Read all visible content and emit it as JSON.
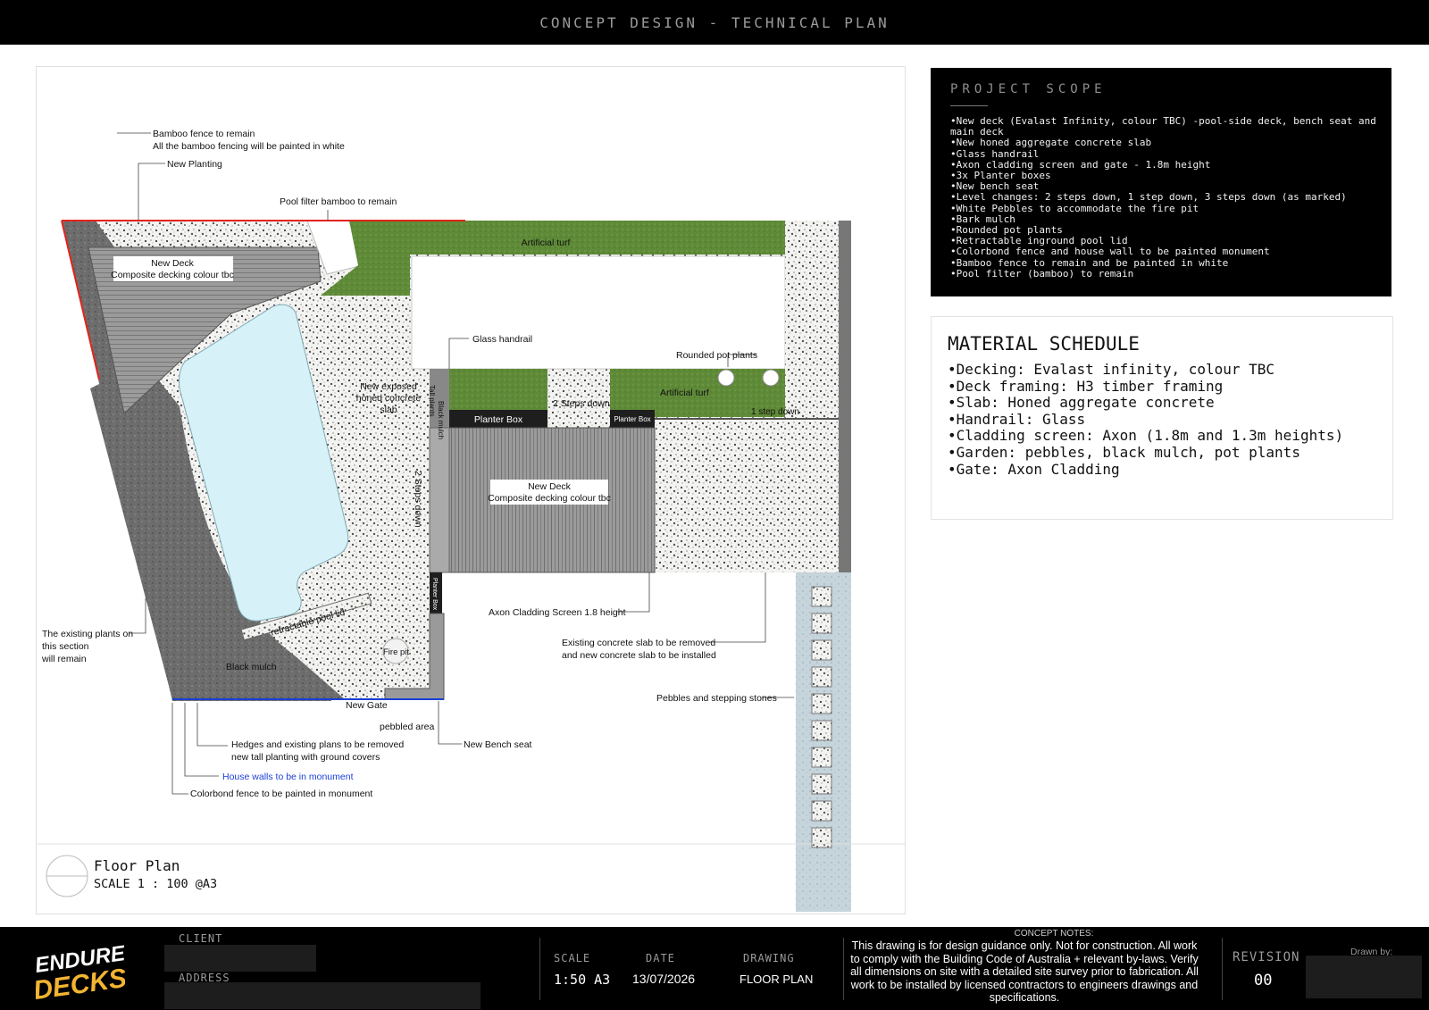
{
  "header": {
    "title": "CONCEPT DESIGN - TECHNICAL PLAN"
  },
  "plan": {
    "labels": {
      "bamboo_remain": "Bamboo fence to remain",
      "bamboo_paint": "All the bamboo fencing will be painted in white",
      "new_planting": "New Planting",
      "pool_filter": "Pool filter bamboo to remain",
      "deck1_title": "New Deck",
      "deck1_sub": "Composite decking colour tbc",
      "artificial_turf_top": "Artificial turf",
      "glass_handrail": "Glass handrail",
      "rounded_pot": "Rounded pot plants",
      "new_exposed": "New exposed honed concrete slab",
      "black_mulch_small": "Black mulch",
      "tall_plants": "Tall plants",
      "two_steps_top": "2 Steps down",
      "artificial_turf_mid": "Artificial turf",
      "planter_box_1": "Planter Box",
      "planter_box_2": "Planter Box",
      "one_step": "1 step down",
      "two_steps_side": "2 Steps down",
      "deck2_title": "New Deck",
      "deck2_sub": "Composite decking colour tbc",
      "planter_box_3": "Planter Box",
      "axon_screen": "Axon Cladding Screen 1.8 height",
      "existing_slab_1": "Existing concrete slab to be removed",
      "existing_slab_2": "and new concrete slab to be installed",
      "pebbles_stones": "Pebbles and stepping stones",
      "retractable": "retractable pool lid",
      "fire_pit": "Fire pit",
      "black_mulch": "Black mulch",
      "existing_plants_1": "The existing plants on",
      "existing_plants_2": "this section",
      "existing_plants_3": "will remain",
      "new_gate": "New Gate",
      "pebbled_area": "pebbled area",
      "new_bench": "New Bench seat",
      "hedges_1": "Hedges and existing plans to be removed",
      "hedges_2": "new tall planting with ground covers",
      "house_walls": "House walls to be in monument",
      "colorbond": "Colorbond fence to be painted in monument"
    },
    "caption": {
      "title": "Floor Plan",
      "scale": "SCALE 1 : 100 @A3"
    },
    "colors": {
      "grass": "#5f8a38",
      "pool": "#d6f2f8",
      "fence_red": "#e2231a",
      "wall_blue": "#1a3fd6",
      "mulch": "#6b6b6b",
      "deck": "#9a9a9a"
    }
  },
  "scope": {
    "title": "PROJECT SCOPE",
    "items": [
      "•New deck (Evalast Infinity, colour TBC) -pool-side deck, bench seat and main deck",
      "•New honed aggregate concrete slab",
      "•Glass handrail",
      "•Axon cladding screen and gate - 1.8m height",
      "•3x Planter boxes",
      "•New bench seat",
      "•Level changes: 2 steps down, 1 step down, 3 steps down (as marked)",
      "•White Pebbles to accommodate the fire pit",
      "•Bark mulch",
      "•Rounded pot plants",
      "•Retractable inground pool lid",
      "•Colorbond fence and house wall to be painted monument",
      "•Bamboo fence to remain and be painted in white",
      "•Pool filter (bamboo) to remain"
    ]
  },
  "material": {
    "title": "MATERIAL SCHEDULE",
    "items": [
      "•Decking: Evalast infinity, colour TBC",
      "•Deck framing: H3 timber framing",
      "•Slab: Honed aggregate concrete",
      "•Handrail: Glass",
      "•Cladding screen: Axon (1.8m and 1.3m heights)",
      "•Garden: pebbles, black mulch, pot plants",
      "•Gate: Axon Cladding"
    ]
  },
  "titleblock": {
    "logo_top": "ENDURE",
    "logo_bottom": "DECKS",
    "client_label": "CLIENT",
    "address_label": "ADDRESS",
    "scale_label": "SCALE",
    "scale_value": "1:50 A3",
    "date_label": "DATE",
    "date_value": "13/07/2026",
    "drawing_label": "DRAWING",
    "drawing_value": "FLOOR PLAN",
    "notes_title": "CONCEPT NOTES:",
    "notes_text": "This drawing is for design guidance only. Not for construction. All work to comply with the Building Code of Australia + relevant by-laws. Verify all dimensions on site with a detailed site survey prior to fabrication. All work to be installed by licensed contractors to engineers drawings and specifications.",
    "revision_label": "REVISION",
    "revision_value": "00",
    "drawn_by_label": "Drawn by:"
  }
}
